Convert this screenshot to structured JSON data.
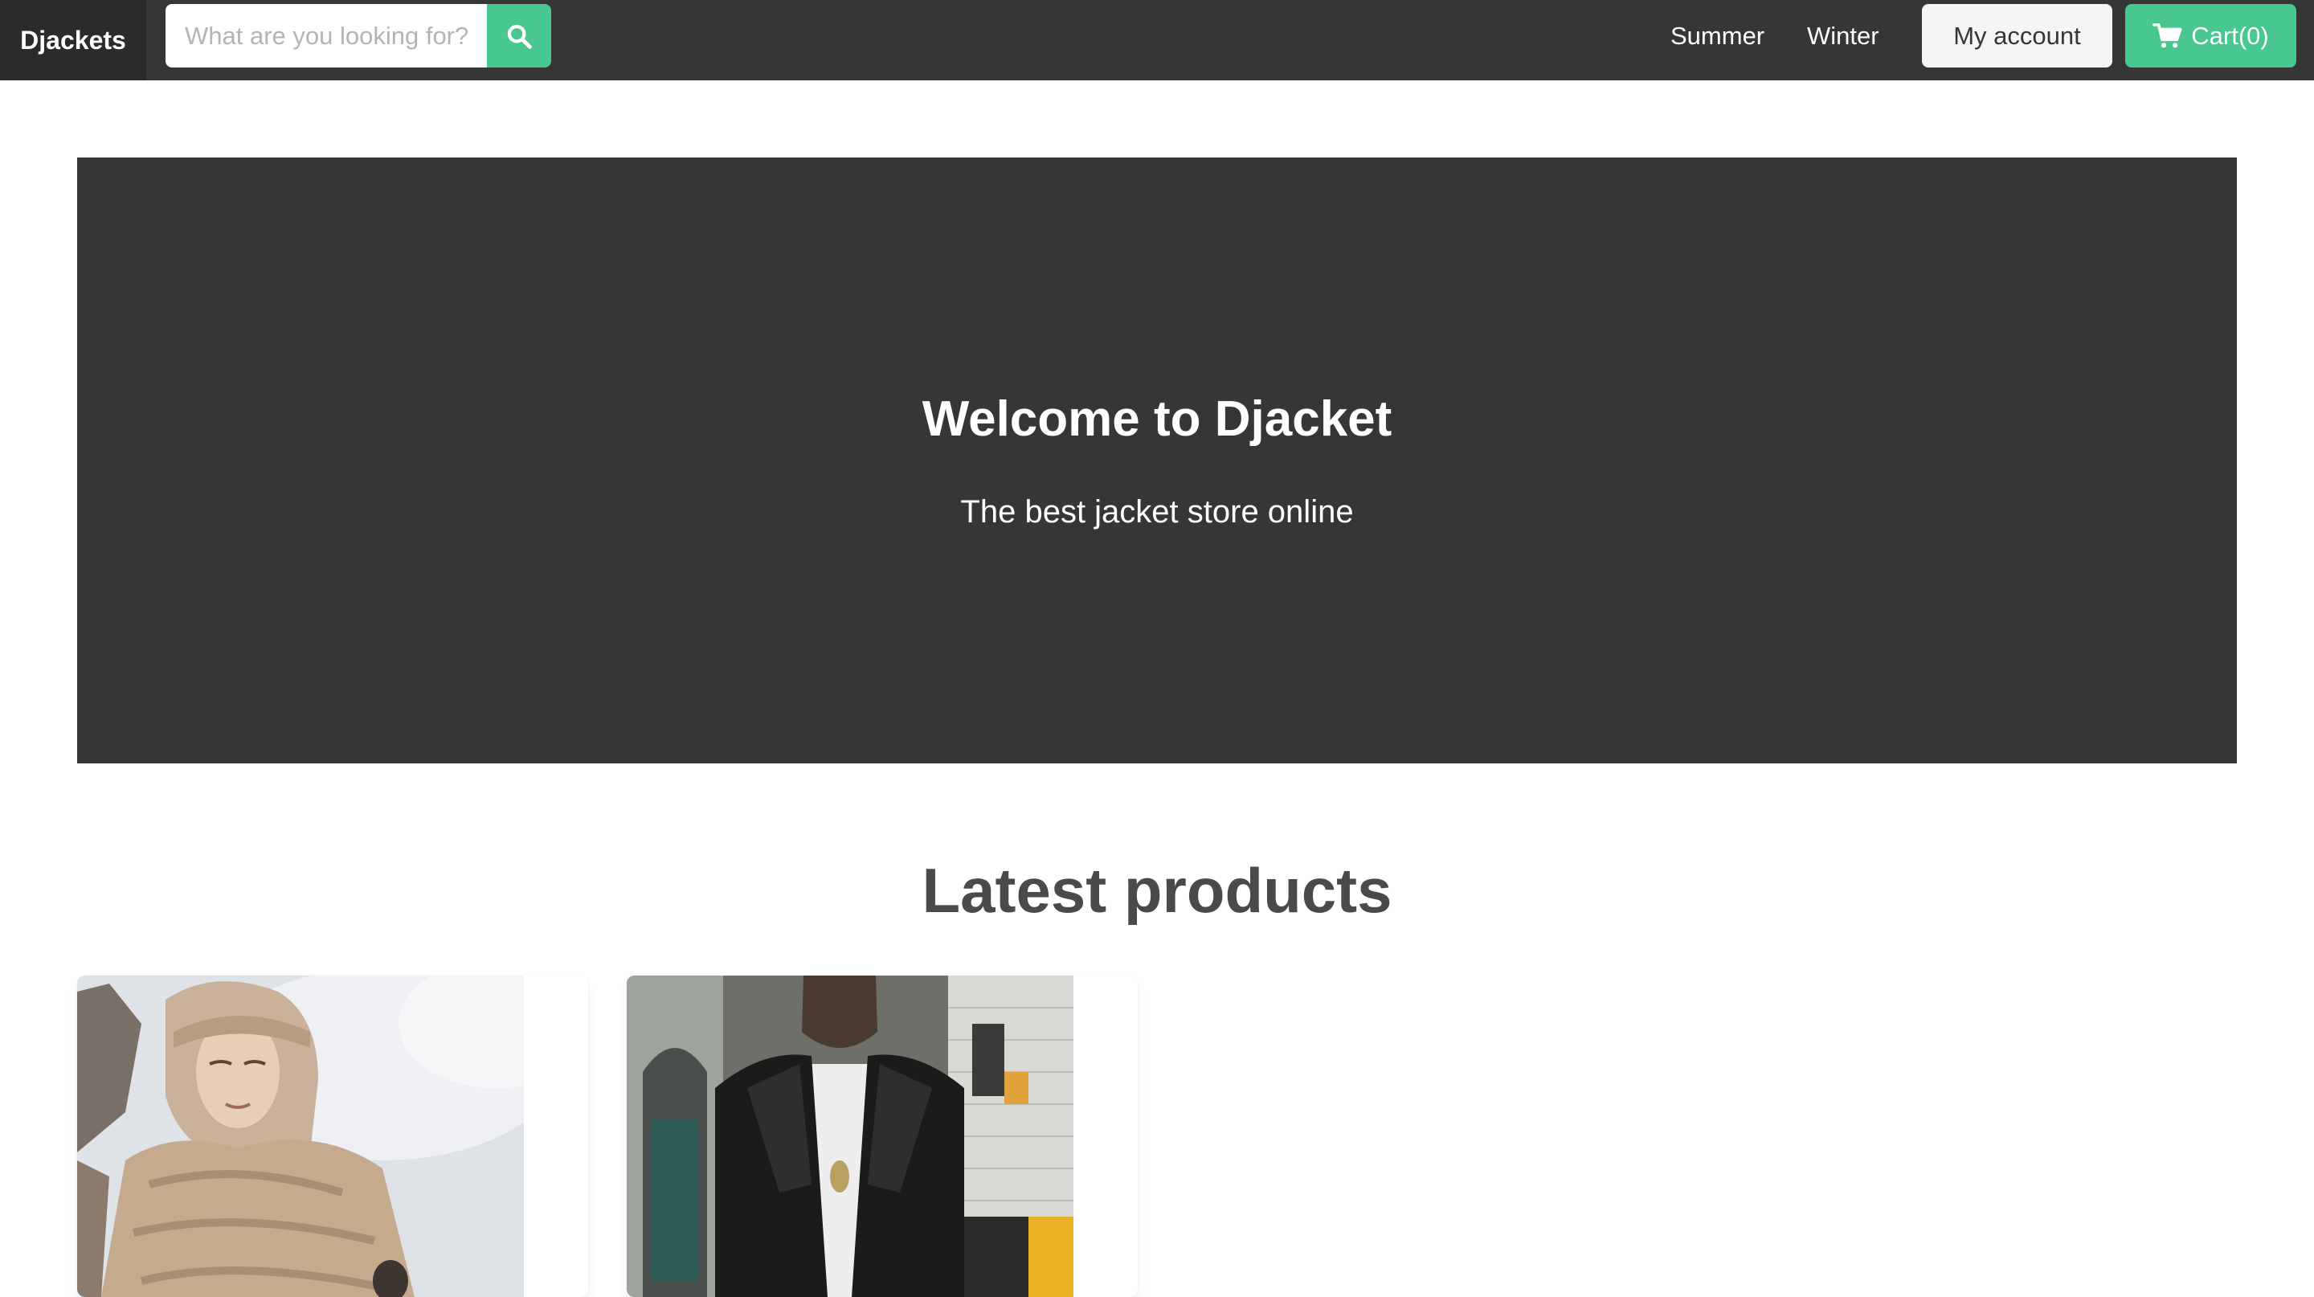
{
  "navbar": {
    "brand": "Djackets",
    "search_placeholder": "What are you looking for?",
    "links": [
      "Summer",
      "Winter"
    ],
    "account_label": "My account",
    "cart_label": "Cart(0)",
    "icons": {
      "search": "search-icon",
      "cart": "shopping-cart-icon"
    }
  },
  "hero": {
    "title": "Welcome to Djacket",
    "subtitle": "The best jacket store online"
  },
  "products": {
    "heading": "Latest products",
    "items": [
      {
        "image": "beige-puffer-jacket-photo"
      },
      {
        "image": "black-leather-jacket-photo"
      }
    ]
  },
  "colors": {
    "navbar_bg": "#363636",
    "hero_bg": "#363636",
    "accent_green": "#48c78e",
    "light_button_bg": "#f5f5f5"
  }
}
